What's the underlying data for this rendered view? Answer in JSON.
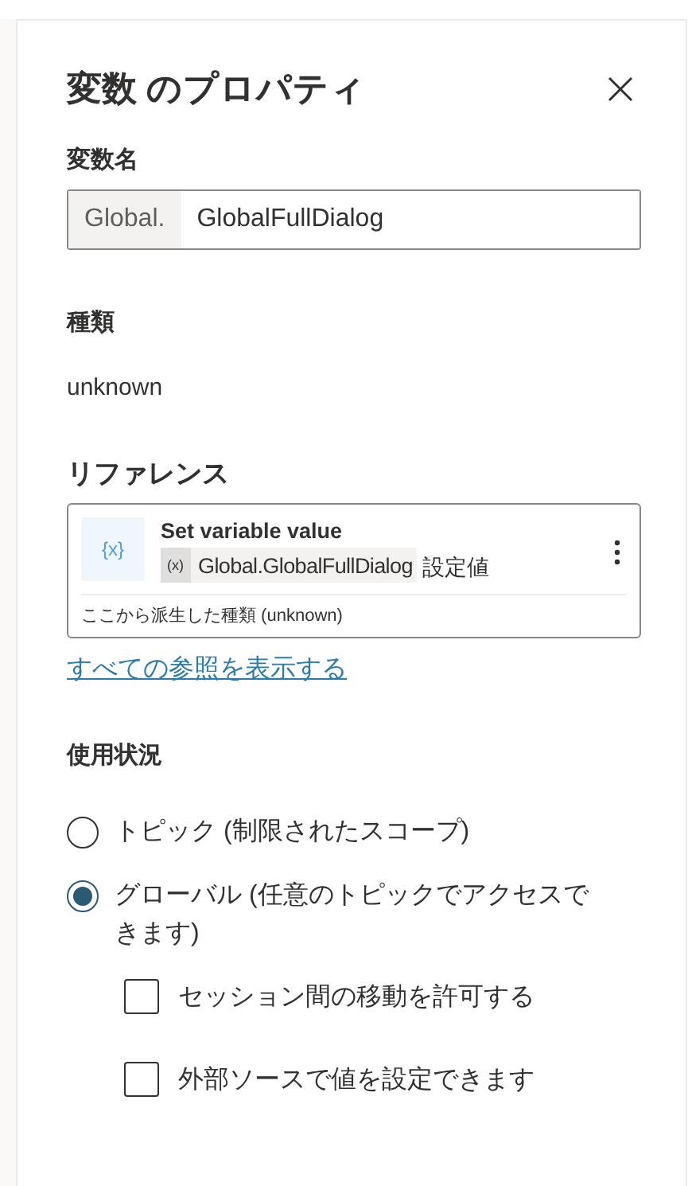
{
  "panel": {
    "title": "変数 のプロパティ"
  },
  "name_field": {
    "label": "変数名",
    "prefix": "Global.",
    "value": "GlobalFullDialog"
  },
  "type_section": {
    "label": "種類",
    "value": "unknown"
  },
  "references": {
    "label": "リファレンス",
    "items": [
      {
        "tile_icon": "{x}",
        "title": "Set variable value",
        "chip_icon": "(x)",
        "chip": "Global.GlobalFullDialog",
        "suffix": "設定値",
        "note": "ここから派生した種類 (unknown)"
      }
    ],
    "link": "すべての参照を表示する"
  },
  "usage": {
    "label": "使用状況",
    "options": [
      {
        "label": "トピック (制限されたスコープ)",
        "selected": false
      },
      {
        "label": "グローバル (任意のトピックでアクセスできます)",
        "selected": true
      }
    ],
    "checkboxes": [
      {
        "label": "セッション間の移動を許可する",
        "checked": false
      },
      {
        "label": "外部ソースで値を設定できます",
        "checked": false
      }
    ]
  }
}
